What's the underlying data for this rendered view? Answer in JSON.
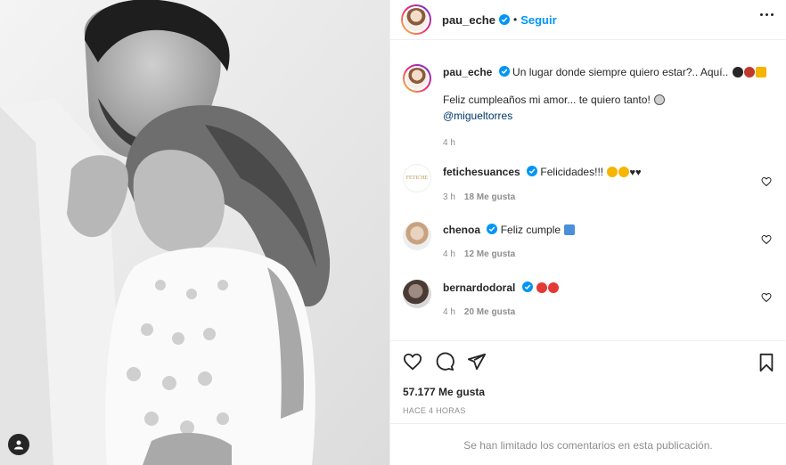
{
  "post": {
    "username": "pau_eche",
    "follow_label": "Seguir",
    "caption_line1": "Un lugar donde siempre quiero estar?.. Aquí..",
    "caption_line2": "Feliz cumpleaños mi amor... te quiero tanto!",
    "caption_mention": "@migueltorres",
    "caption_time": "4 h"
  },
  "comments": [
    {
      "username": "fetichesuances",
      "text": "Felicidades!!!",
      "time": "3 h",
      "likes": "18 Me gusta"
    },
    {
      "username": "chenoa",
      "text": "Feliz cumple",
      "time": "4 h",
      "likes": "12 Me gusta"
    },
    {
      "username": "bernardodoral",
      "text": "",
      "time": "4 h",
      "likes": "20 Me gusta"
    }
  ],
  "footer": {
    "likes": "57.177 Me gusta",
    "timestamp": "HACE 4 HORAS",
    "limited": "Se han limitado los comentarios en esta publicación."
  },
  "colors": {
    "accent": "#0095f6",
    "text": "#262626",
    "muted": "#8e8e8e",
    "border": "#efefef"
  },
  "icons": [
    "verified-icon",
    "more-icon",
    "heart-icon",
    "comment-icon",
    "share-icon",
    "bookmark-icon",
    "tag-user-icon"
  ]
}
